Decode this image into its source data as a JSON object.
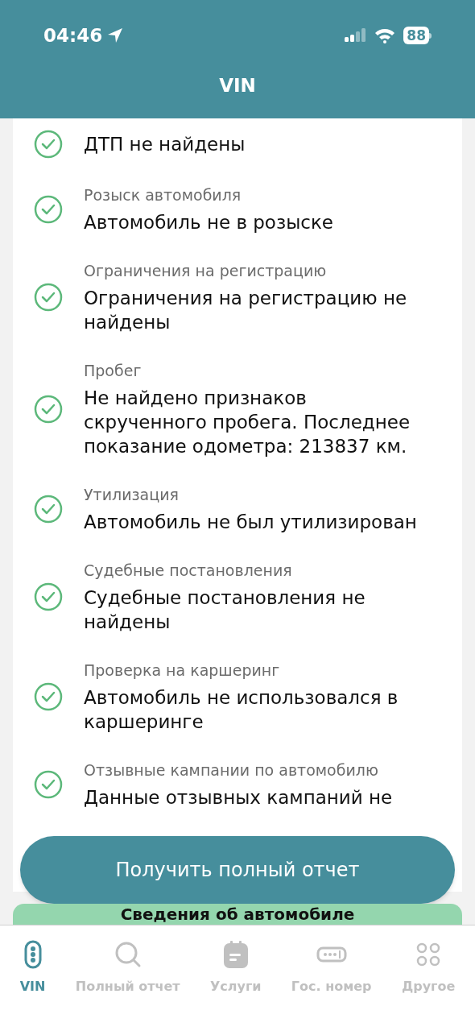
{
  "status_bar": {
    "time": "04:46",
    "battery": "88"
  },
  "header": {
    "title": "VIN"
  },
  "checks": [
    {
      "value": "ДТП не найдены"
    },
    {
      "title": "Розыск автомобиля",
      "value": "Автомобиль не в розыске"
    },
    {
      "title": "Ограничения на регистрацию",
      "value": "Ограничения на регистрацию не найдены"
    },
    {
      "title": "Пробег",
      "value": "Не найдено признаков скрученного пробега. Последнее показание одометра: 213837 км."
    },
    {
      "title": "Утилизация",
      "value": "Автомобиль не был утилизирован"
    },
    {
      "title": "Судебные постановления",
      "value": "Судебные постановления не найдены"
    },
    {
      "title": "Проверка на каршеринг",
      "value": "Автомобиль не использовался в каршеринге"
    },
    {
      "title": "Отзывные кампании по автомобилю",
      "value": "Данные отзывных кампаний не"
    }
  ],
  "full_report_button": "Получить полный отчет",
  "next_section": {
    "title": "Сведения об автомобиле"
  },
  "tabs": [
    {
      "label": "VIN",
      "kind": "vin",
      "selected": true
    },
    {
      "label": "Полный отчет",
      "kind": "search",
      "selected": false
    },
    {
      "label": "Услуги",
      "kind": "services",
      "selected": false
    },
    {
      "label": "Гос. номер",
      "kind": "plate",
      "selected": false
    },
    {
      "label": "Другое",
      "kind": "other",
      "selected": false
    }
  ]
}
